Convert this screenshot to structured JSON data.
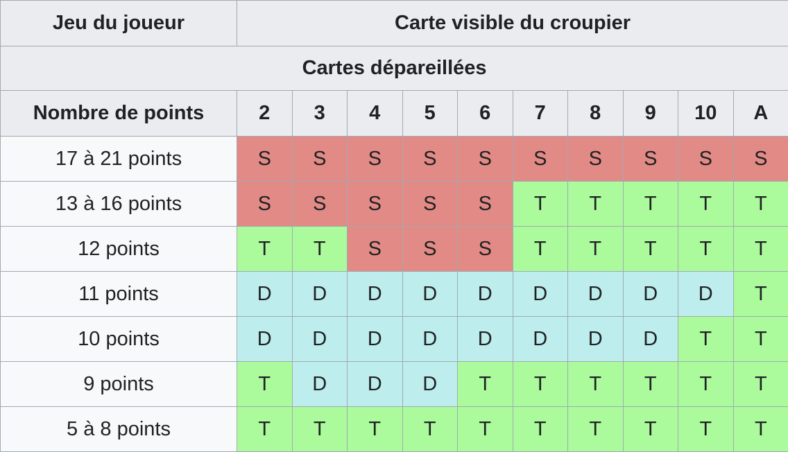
{
  "header": {
    "player_hand": "Jeu du joueur",
    "dealer_card": "Carte visible du croupier",
    "section": "Cartes dépareillées",
    "points_label": "Nombre de points",
    "dealer_values": [
      "2",
      "3",
      "4",
      "5",
      "6",
      "7",
      "8",
      "9",
      "10",
      "A"
    ]
  },
  "rows": [
    {
      "label": "17 à 21 points",
      "cells": [
        "S",
        "S",
        "S",
        "S",
        "S",
        "S",
        "S",
        "S",
        "S",
        "S"
      ]
    },
    {
      "label": "13 à 16 points",
      "cells": [
        "S",
        "S",
        "S",
        "S",
        "S",
        "T",
        "T",
        "T",
        "T",
        "T"
      ]
    },
    {
      "label": "12 points",
      "cells": [
        "T",
        "T",
        "S",
        "S",
        "S",
        "T",
        "T",
        "T",
        "T",
        "T"
      ]
    },
    {
      "label": "11 points",
      "cells": [
        "D",
        "D",
        "D",
        "D",
        "D",
        "D",
        "D",
        "D",
        "D",
        "T"
      ]
    },
    {
      "label": "10 points",
      "cells": [
        "D",
        "D",
        "D",
        "D",
        "D",
        "D",
        "D",
        "D",
        "T",
        "T"
      ]
    },
    {
      "label": "9 points",
      "cells": [
        "T",
        "D",
        "D",
        "D",
        "T",
        "T",
        "T",
        "T",
        "T",
        "T"
      ]
    },
    {
      "label": "5 à 8 points",
      "cells": [
        "T",
        "T",
        "T",
        "T",
        "T",
        "T",
        "T",
        "T",
        "T",
        "T"
      ]
    }
  ],
  "colors": {
    "S": "#e28a86",
    "T": "#abfb9d",
    "D": "#bdeded",
    "header_bg": "#eaecf0",
    "row_label_bg": "#f8f9fa",
    "border": "#a2a9b1"
  }
}
